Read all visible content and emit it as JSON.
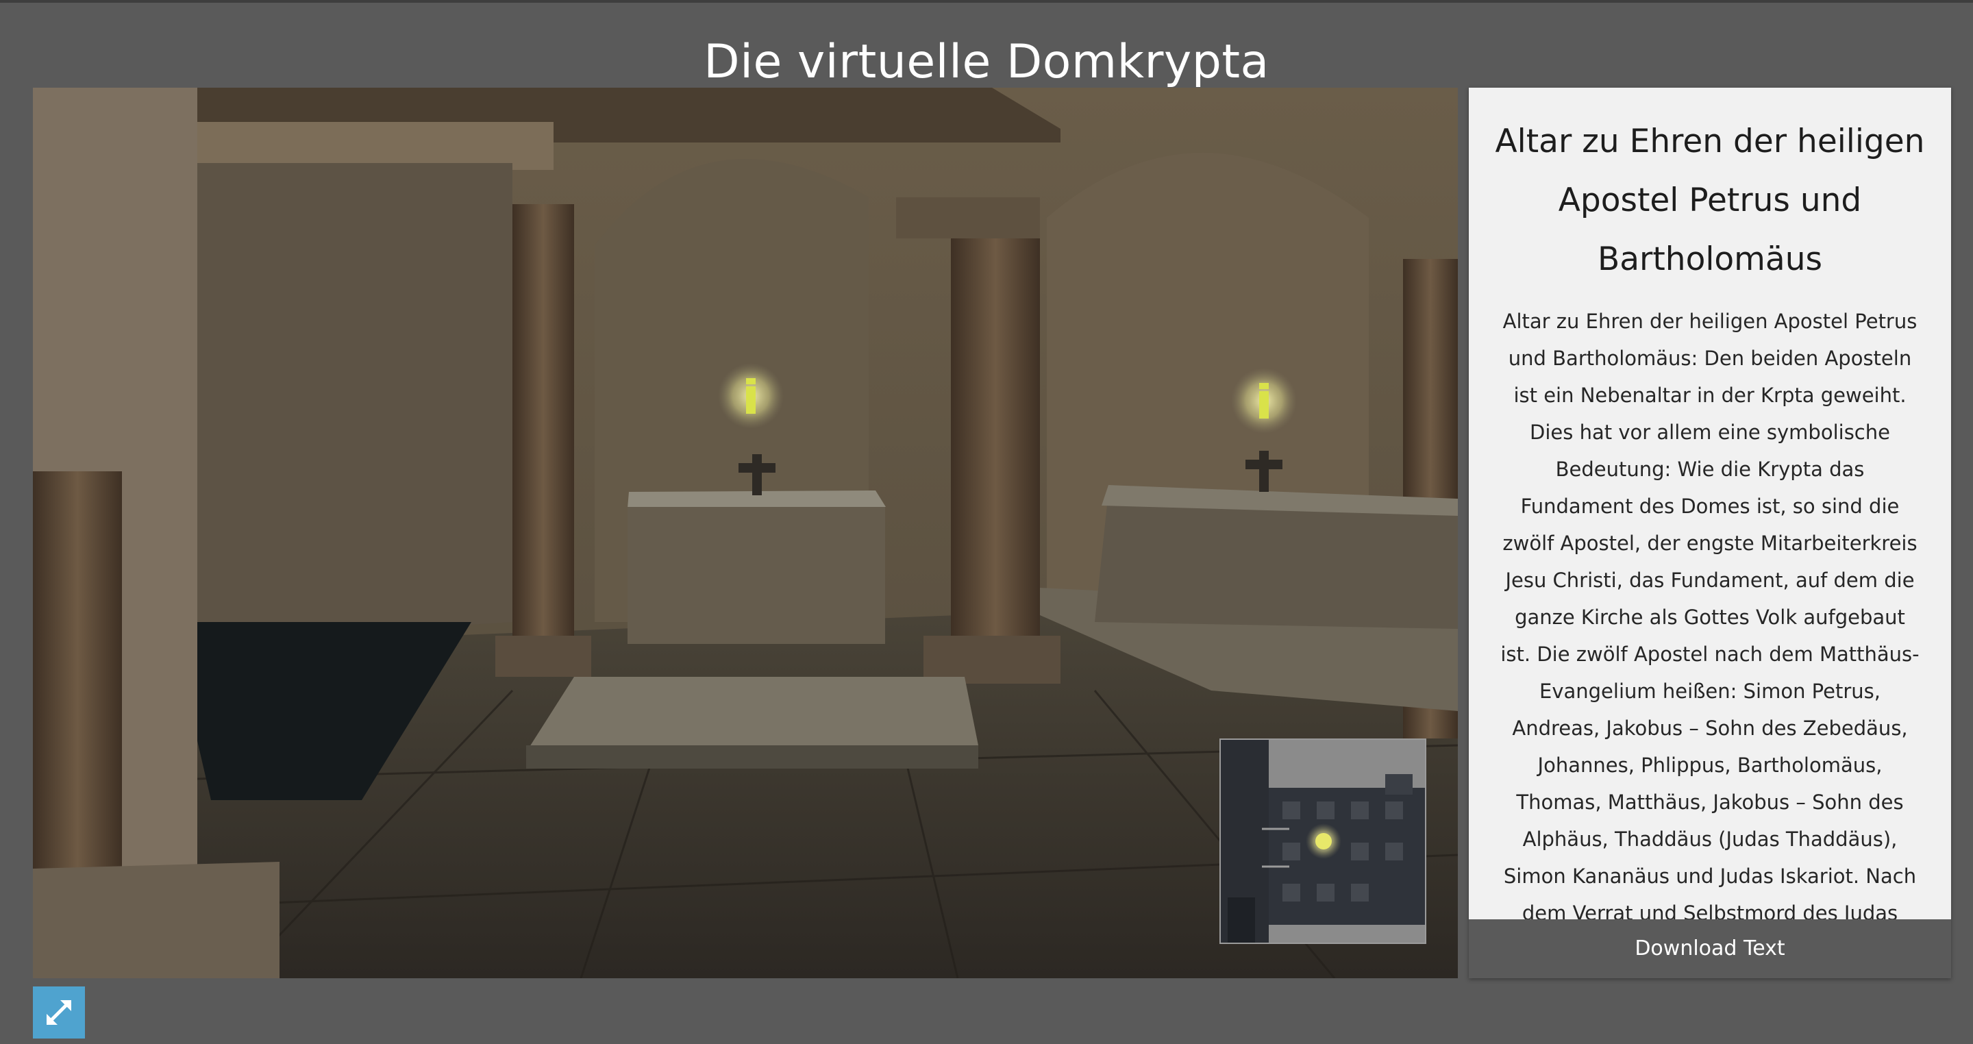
{
  "page": {
    "title": "Die virtuelle Domkrypta"
  },
  "viewer": {
    "hotspot_icon": "info-icon",
    "colors": {
      "hotspot_glow": "#f4ef9a",
      "hotspot_icon": "#d9e24a",
      "minimap_marker": "#e8e86a"
    }
  },
  "info_panel": {
    "title": "Altar zu Ehren der heiligen Apostel Petrus und Bartholomäus",
    "body": "Altar zu Ehren der heiligen Apostel Petrus und Bartholomäus: Den beiden Aposteln ist ein Nebenaltar in der Krpta geweiht. Dies hat vor allem eine symbolische Bedeutung: Wie die Krypta das Fundament des Domes ist, so sind die zwölf Apostel, der engste Mitarbeiterkreis Jesu Christi, das Fundament, auf dem die ganze Kirche als Gottes Volk aufgebaut ist. Die zwölf Apostel nach dem Matthäus-Evangelium heißen: Simon Petrus, Andreas, Jakobus – Sohn des Zebedäus, Johannes, Phlippus, Bartholomäus, Thomas, Matthäus, Jakobus – Sohn des Alphäus, Thaddäus (Judas Thaddäus), Simon Kananäus und Judas Iskariot. Nach dem Verrat und Selbstmord des Judas wurde Matthias in den Kreis",
    "download_label": "Download Text"
  },
  "controls": {
    "fullscreen_icon": "expand-icon",
    "accent": "#4fa3cf"
  }
}
